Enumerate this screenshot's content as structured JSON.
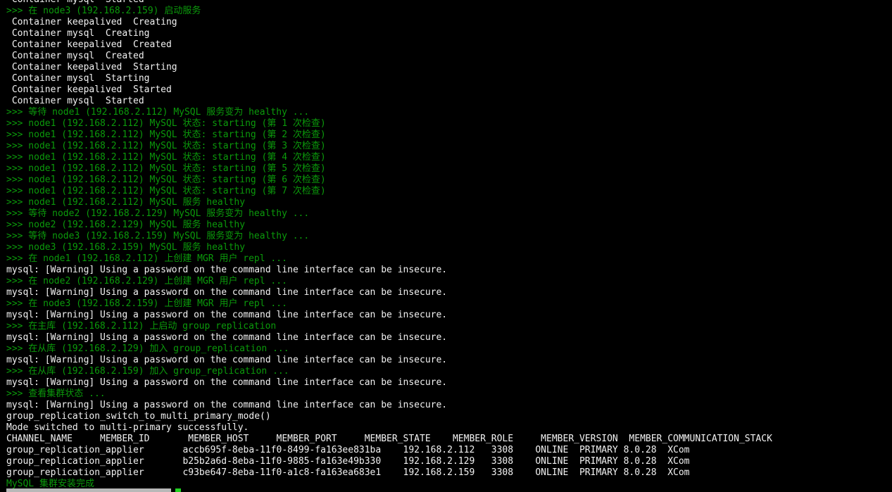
{
  "terminal": {
    "colors": {
      "background": "#000000",
      "text": "#f2f2f2",
      "log": "#0b9a0b",
      "cursor": "#22d322"
    },
    "lines": [
      {
        "text": " Container mysql  Started",
        "color": "white"
      },
      {
        "text": ">>> 在 node3 (192.168.2.159) 启动服务",
        "color": "green"
      },
      {
        "text": " Container keepalived  Creating",
        "color": "white"
      },
      {
        "text": " Container mysql  Creating",
        "color": "white"
      },
      {
        "text": " Container keepalived  Created",
        "color": "white"
      },
      {
        "text": " Container mysql  Created",
        "color": "white"
      },
      {
        "text": " Container keepalived  Starting",
        "color": "white"
      },
      {
        "text": " Container mysql  Starting",
        "color": "white"
      },
      {
        "text": " Container keepalived  Started",
        "color": "white"
      },
      {
        "text": " Container mysql  Started",
        "color": "white"
      },
      {
        "text": ">>> 等待 node1 (192.168.2.112) MySQL 服务变为 healthy ...",
        "color": "green"
      },
      {
        "text": ">>> node1 (192.168.2.112) MySQL 状态: starting (第 1 次检查)",
        "color": "green"
      },
      {
        "text": ">>> node1 (192.168.2.112) MySQL 状态: starting (第 2 次检查)",
        "color": "green"
      },
      {
        "text": ">>> node1 (192.168.2.112) MySQL 状态: starting (第 3 次检查)",
        "color": "green"
      },
      {
        "text": ">>> node1 (192.168.2.112) MySQL 状态: starting (第 4 次检查)",
        "color": "green"
      },
      {
        "text": ">>> node1 (192.168.2.112) MySQL 状态: starting (第 5 次检查)",
        "color": "green"
      },
      {
        "text": ">>> node1 (192.168.2.112) MySQL 状态: starting (第 6 次检查)",
        "color": "green"
      },
      {
        "text": ">>> node1 (192.168.2.112) MySQL 状态: starting (第 7 次检查)",
        "color": "green"
      },
      {
        "text": ">>> node1 (192.168.2.112) MySQL 服务 healthy",
        "color": "green"
      },
      {
        "text": ">>> 等待 node2 (192.168.2.129) MySQL 服务变为 healthy ...",
        "color": "green"
      },
      {
        "text": ">>> node2 (192.168.2.129) MySQL 服务 healthy",
        "color": "green"
      },
      {
        "text": ">>> 等待 node3 (192.168.2.159) MySQL 服务变为 healthy ...",
        "color": "green"
      },
      {
        "text": ">>> node3 (192.168.2.159) MySQL 服务 healthy",
        "color": "green"
      },
      {
        "text": ">>> 在 node1 (192.168.2.112) 上创建 MGR 用户 repl ...",
        "color": "green"
      },
      {
        "text": "mysql: [Warning] Using a password on the command line interface can be insecure.",
        "color": "white"
      },
      {
        "text": ">>> 在 node2 (192.168.2.129) 上创建 MGR 用户 repl ...",
        "color": "green"
      },
      {
        "text": "mysql: [Warning] Using a password on the command line interface can be insecure.",
        "color": "white"
      },
      {
        "text": ">>> 在 node3 (192.168.2.159) 上创建 MGR 用户 repl ...",
        "color": "green"
      },
      {
        "text": "mysql: [Warning] Using a password on the command line interface can be insecure.",
        "color": "white"
      },
      {
        "text": ">>> 在主库 (192.168.2.112) 上启动 group_replication",
        "color": "green"
      },
      {
        "text": "mysql: [Warning] Using a password on the command line interface can be insecure.",
        "color": "white"
      },
      {
        "text": ">>> 在从库 (192.168.2.129) 加入 group_replication ...",
        "color": "green"
      },
      {
        "text": "mysql: [Warning] Using a password on the command line interface can be insecure.",
        "color": "white"
      },
      {
        "text": ">>> 在从库 (192.168.2.159) 加入 group_replication ...",
        "color": "green"
      },
      {
        "text": "mysql: [Warning] Using a password on the command line interface can be insecure.",
        "color": "white"
      },
      {
        "text": ">>> 查看集群状态 ...",
        "color": "green"
      },
      {
        "text": "mysql: [Warning] Using a password on the command line interface can be insecure.",
        "color": "white"
      },
      {
        "text": "group_replication_switch_to_multi_primary_mode()",
        "color": "white"
      },
      {
        "text": "Mode switched to multi-primary successfully.",
        "color": "white"
      },
      {
        "text": "CHANNEL_NAME     MEMBER_ID       MEMBER_HOST     MEMBER_PORT     MEMBER_STATE    MEMBER_ROLE     MEMBER_VERSION  MEMBER_COMMUNICATION_STACK",
        "color": "white"
      },
      {
        "text": "group_replication_applier       accb695f-8eba-11f0-8499-fa163ee831ba    192.168.2.112   3308    ONLINE  PRIMARY 8.0.28  XCom",
        "color": "white"
      },
      {
        "text": "group_replication_applier       b25b2a6d-8eba-11f0-9885-fa163e49b330    192.168.2.129   3308    ONLINE  PRIMARY 8.0.28  XCom",
        "color": "white"
      },
      {
        "text": "group_replication_applier       c93be647-8eba-11f0-a1c8-fa163ea683e1    192.168.2.159   3308    ONLINE  PRIMARY 8.0.28  XCom",
        "color": "white"
      },
      {
        "text": "MySQL 集群安装完成",
        "color": "green"
      }
    ]
  }
}
